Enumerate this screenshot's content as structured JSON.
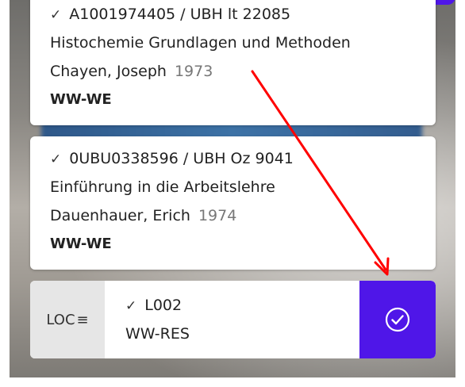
{
  "items": [
    {
      "id_line": "A1001974405 / UBH lt 22085",
      "title": "Histochemie Grundlagen und Methoden",
      "author": "Chayen, Joseph",
      "year": "1973",
      "location": "WW-WE"
    },
    {
      "id_line": "0UBU0338596 / UBH Oz 9041",
      "title": "Einführung in die Arbeitslehre",
      "author": "Dauenhauer, Erich",
      "year": "1974",
      "location": "WW-WE"
    }
  ],
  "scan": {
    "loc_label": "LOC",
    "code": "L002",
    "location": "WW-RES"
  },
  "icons": {
    "check": "✓",
    "menu": "≡"
  },
  "colors": {
    "accent": "#4f16e8",
    "annotation_arrow": "#ff0000"
  }
}
